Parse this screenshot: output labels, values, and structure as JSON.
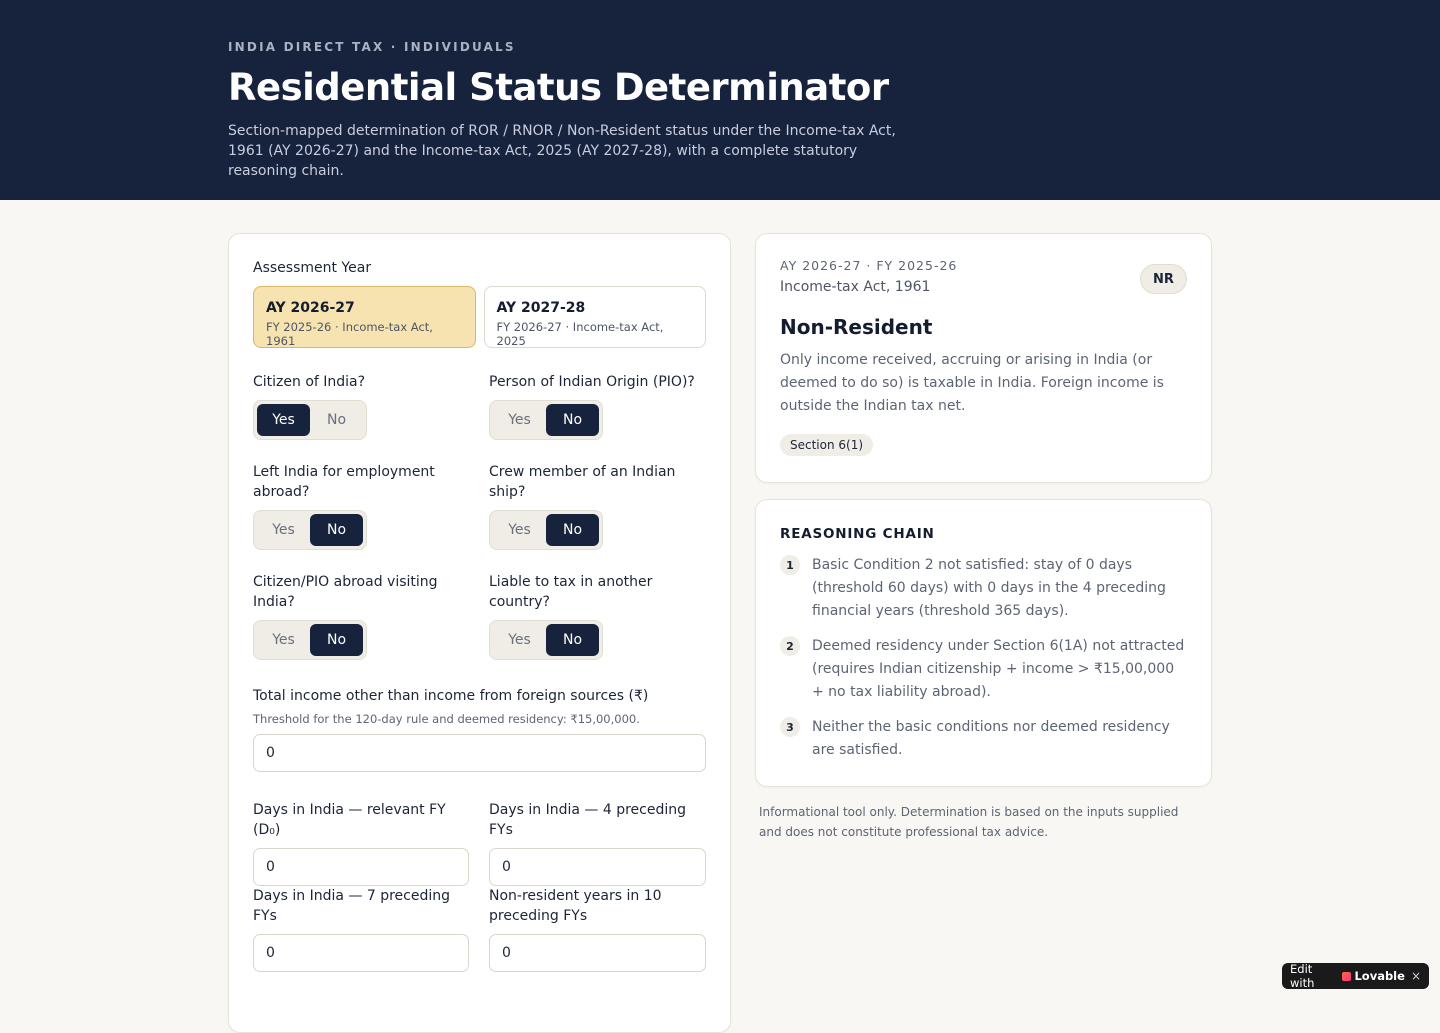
{
  "header": {
    "eyebrow": "INDIA DIRECT TAX · INDIVIDUALS",
    "title": "Residential Status Determinator",
    "subtitle": "Section-mapped determination of ROR / RNOR / Non-Resident status under the Income-tax Act, 1961 (AY 2026-27) and the Income-tax Act, 2025 (AY 2027-28), with a complete statutory reasoning chain."
  },
  "form": {
    "assessment_year_label": "Assessment Year",
    "ay_options": [
      {
        "title": "AY 2026-27",
        "sub": "FY 2025-26 · Income-tax Act, 1961",
        "selected": true
      },
      {
        "title": "AY 2027-28",
        "sub": "FY 2026-27 · Income-tax Act, 2025",
        "selected": false
      }
    ],
    "yes_label": "Yes",
    "no_label": "No",
    "questions": [
      {
        "label": "Citizen of India?",
        "value": "Yes"
      },
      {
        "label": "Person of Indian Origin (PIO)?",
        "value": "No"
      },
      {
        "label": "Left India for employment abroad?",
        "value": "No"
      },
      {
        "label": "Crew member of an Indian ship?",
        "value": "No"
      },
      {
        "label": "Citizen/PIO abroad visiting India?",
        "value": "No"
      },
      {
        "label": "Liable to tax in another country?",
        "value": "No"
      }
    ],
    "income": {
      "label": "Total income other than income from foreign sources (₹)",
      "hint": "Threshold for the 120-day rule and deemed residency: ₹15,00,000.",
      "value": "0"
    },
    "days_current": {
      "label": "Days in India — relevant FY (D₀)",
      "value": "0"
    },
    "days_4": {
      "label": "Days in India — 4 preceding FYs",
      "value": "0"
    },
    "days_7": {
      "label": "Days in India — 7 preceding FYs",
      "value": "0"
    },
    "nr_years": {
      "label": "Non-resident years in 10 preceding FYs",
      "value": "0"
    }
  },
  "result": {
    "meta": "AY 2026-27 · FY 2025-26",
    "act": "Income-tax Act, 1961",
    "badge": "NR",
    "status": "Non-Resident",
    "description": "Only income received, accruing or arising in India (or deemed to do so) is taxable in India. Foreign income is outside the Indian tax net.",
    "section": "Section 6(1)"
  },
  "reasoning": {
    "title": "REASONING CHAIN",
    "steps": [
      {
        "n": "1",
        "text": "Basic Condition 2 not satisfied: stay of 0 days (threshold 60 days) with 0 days in the 4 preceding financial years (threshold 365 days)."
      },
      {
        "n": "2",
        "text": "Deemed residency under Section 6(1A) not attracted (requires Indian citizenship + income > ₹15,00,000 + no tax liability abroad)."
      },
      {
        "n": "3",
        "text": "Neither the basic conditions nor deemed residency are satisfied."
      }
    ]
  },
  "disclaimer": "Informational tool only. Determination is based on the inputs supplied and does not constitute professional tax advice.",
  "badge_widget": {
    "prefix": "Edit with",
    "brand": "Lovable",
    "close": "×"
  }
}
